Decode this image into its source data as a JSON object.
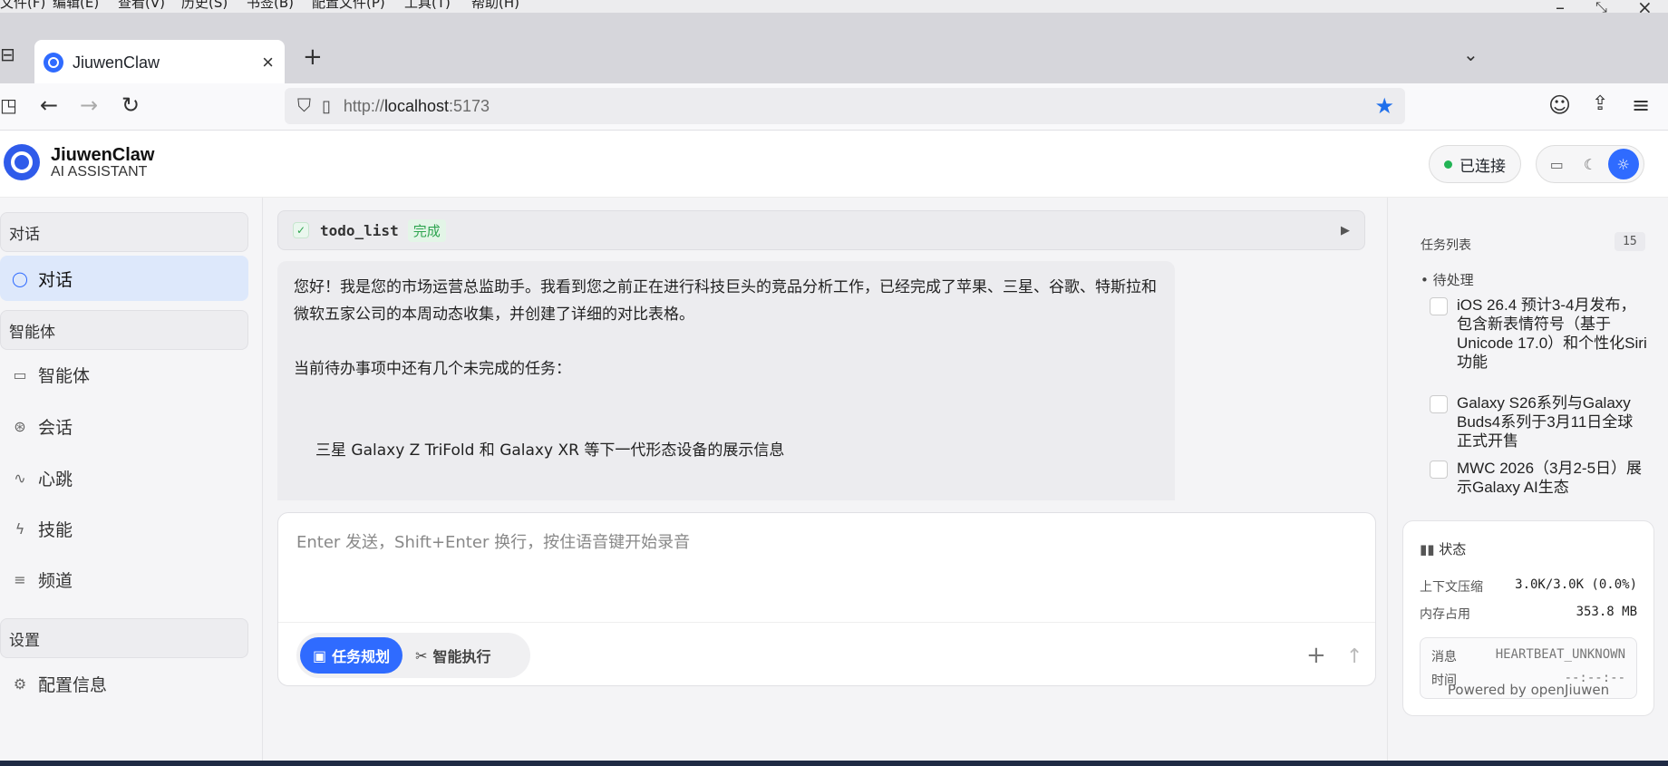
{
  "browser": {
    "menu": [
      "文件(F)",
      "编辑(E)",
      "查看(V)",
      "历史(S)",
      "书签(B)",
      "配置文件(P)",
      "工具(T)",
      "帮助(H)"
    ],
    "tab_title": "JiuwenClaw",
    "url_prefix": "http://",
    "url_host": "localhost",
    "url_port": ":5173"
  },
  "app": {
    "brand_name": "JiuwenClaw",
    "brand_sub": "AI ASSISTANT",
    "status_label": "已连接",
    "status_color": "#22b455",
    "accent_color": "#2f6bff"
  },
  "sidebar": {
    "sections": [
      "对话",
      "智能体",
      "设置"
    ],
    "items": [
      {
        "label": "对话",
        "icon": "chat-bubble-icon",
        "active": true
      },
      {
        "label": "智能体",
        "icon": "monitor-icon"
      },
      {
        "label": "会话",
        "icon": "session-icon"
      },
      {
        "label": "心跳",
        "icon": "heartbeat-icon"
      },
      {
        "label": "技能",
        "icon": "lightning-icon"
      },
      {
        "label": "频道",
        "icon": "menu-lines-icon"
      },
      {
        "label": "配置信息",
        "icon": "gear-icon"
      }
    ]
  },
  "chat": {
    "tool_name": "todo_list",
    "tool_status": "完成",
    "message_p1": "您好！我是您的市场运营总监助手。我看到您之前正在进行科技巨头的竞品分析工作，已经完成了苹果、三星、谷歌、特斯拉和微软五家公司的本周动态收集，并创建了详细的对比表格。",
    "message_p2": "当前待办事项中还有几个未完成的任务：",
    "message_p3": "三星 Galaxy Z TriFold 和 Galaxy XR 等下一代形态设备的展示信息",
    "input_placeholder": "Enter 发送，Shift+Enter 换行，按住语音键开始录音",
    "mode_plan": "任务规划",
    "mode_exec": "智能执行"
  },
  "tasks": {
    "title": "任务列表",
    "count": "15",
    "pending_label": "待处理",
    "items": [
      "iOS 26.4 预计3-4月发布，包含新表情符号（基于Unicode 17.0）和个性化Siri功能",
      "Galaxy S26系列与Galaxy Buds4系列于3月11日全球正式开售",
      "MWC 2026（3月2-5日）展示Galaxy AI生态"
    ]
  },
  "status": {
    "title": "状态",
    "context_label": "上下文压缩",
    "context_value": "3.0K/3.0K (0.0%)",
    "memory_label": "内存占用",
    "memory_value": "353.8 MB",
    "msg_label": "消息",
    "msg_value": "HEARTBEAT_UNKNOWN",
    "time_label": "时间",
    "time_value": "--:--:--"
  },
  "footer": "Powered by openJiuwen"
}
